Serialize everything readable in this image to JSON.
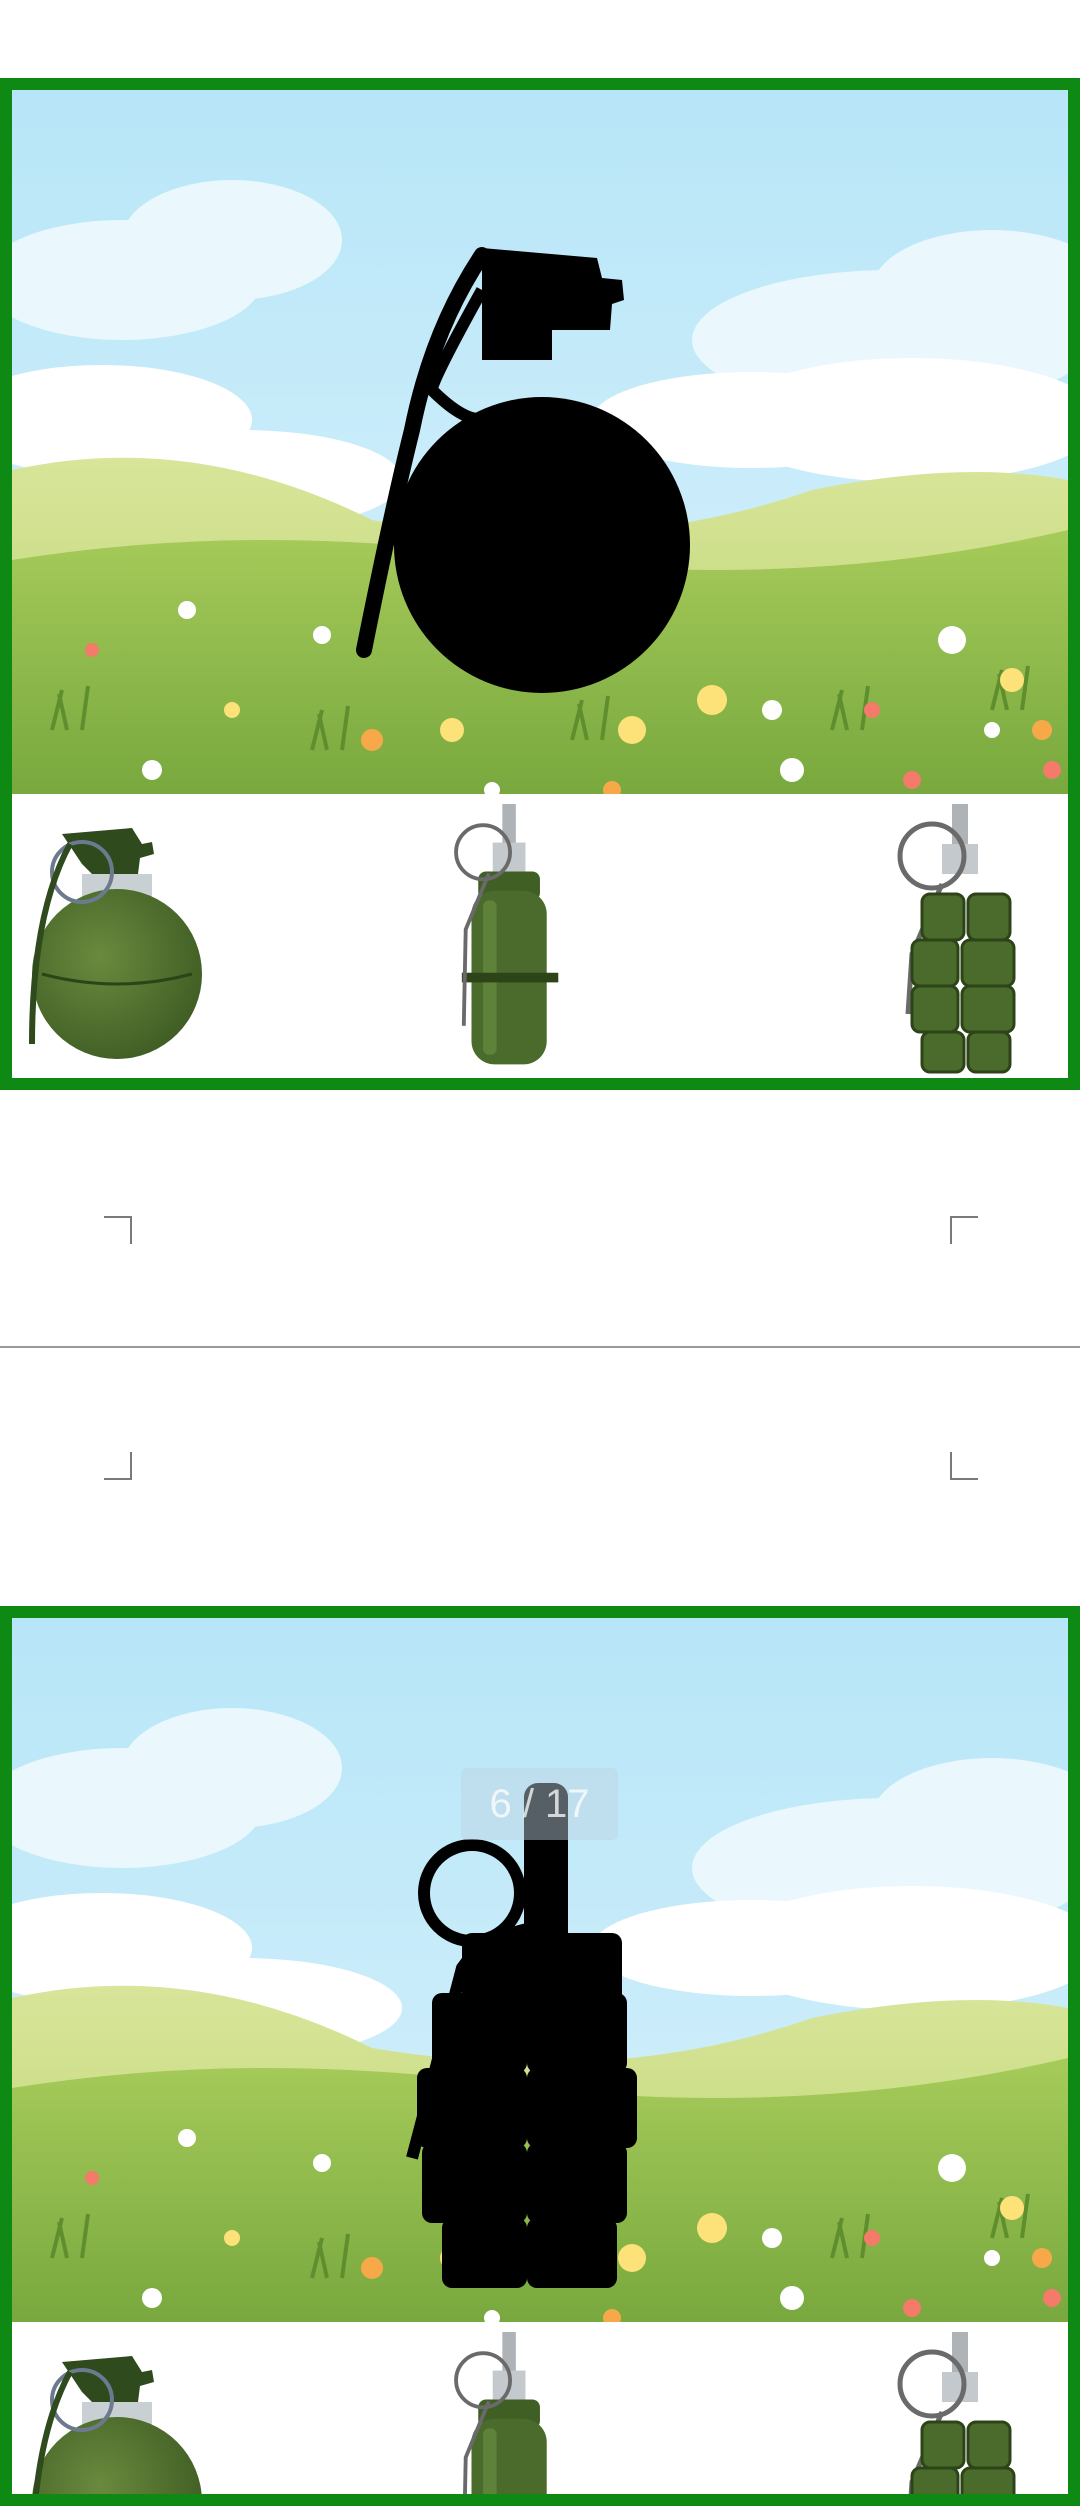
{
  "colors": {
    "frame_border": "#0e8a14",
    "sky_top": "#b9e8f8",
    "meadow": "#8fbf4a",
    "silhouette": "#000000",
    "grenade_green": "#4a6b2c"
  },
  "puzzles": [
    {
      "silhouette": "round-grenade-silhouette",
      "choices": [
        "round-grenade",
        "pineapple-stick-grenade",
        "frag-grenade"
      ]
    },
    {
      "silhouette": "frag-grenade-silhouette",
      "choices": [
        "round-grenade",
        "pineapple-stick-grenade",
        "frag-grenade"
      ]
    }
  ],
  "reader": {
    "page_counter": "6 / 17"
  }
}
